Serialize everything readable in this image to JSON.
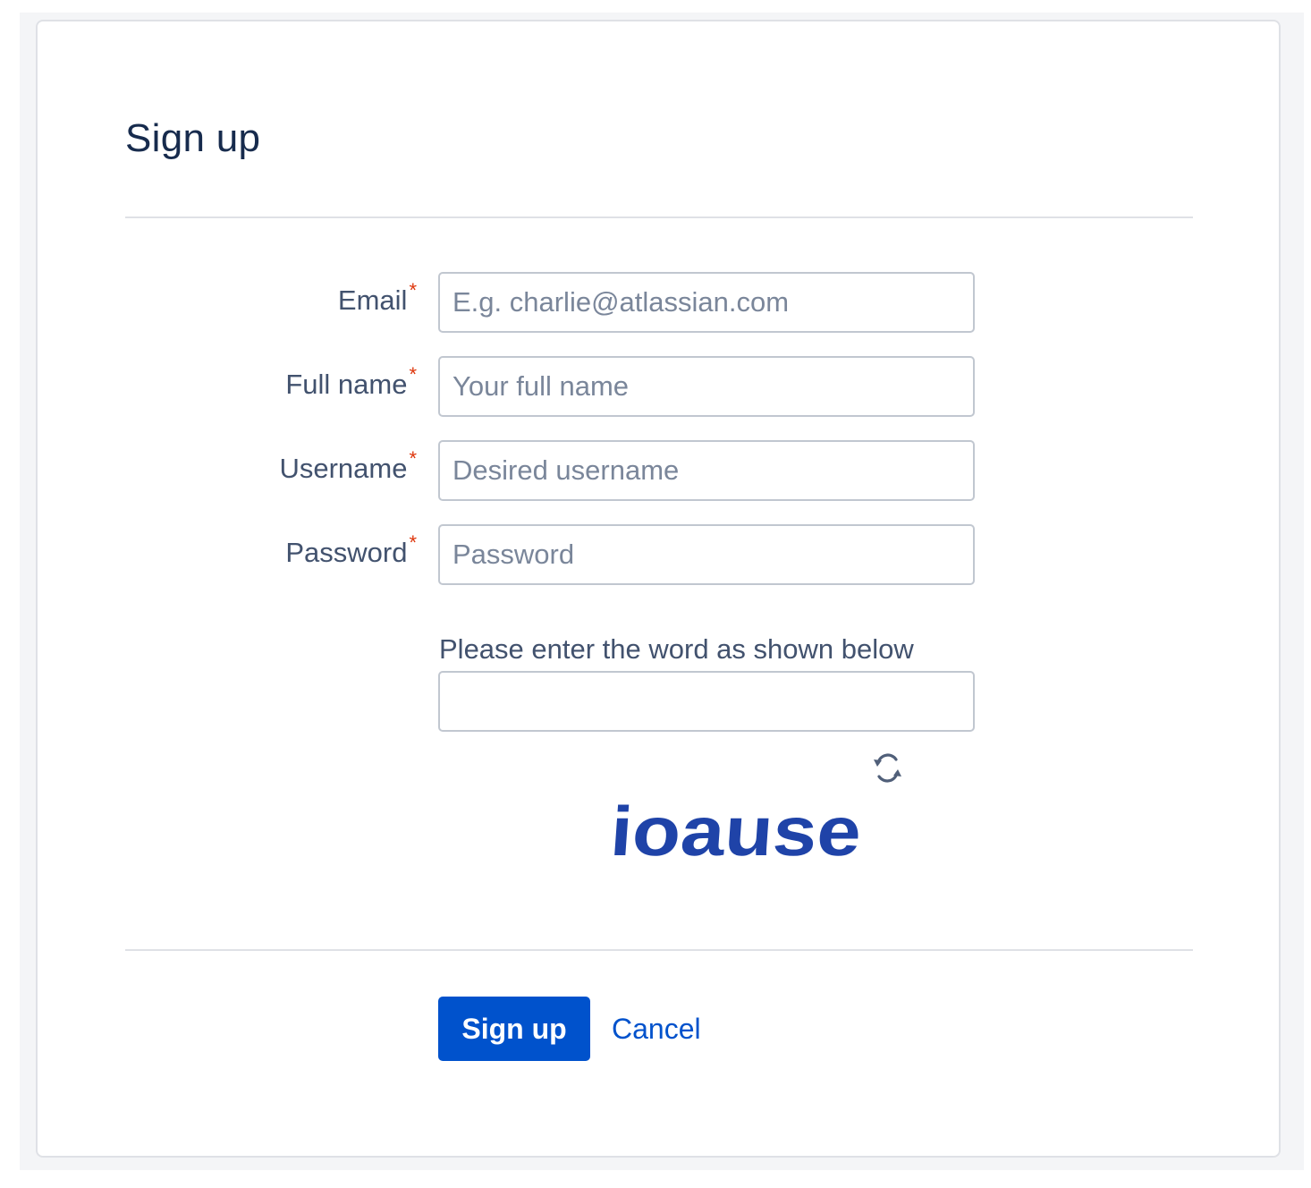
{
  "page": {
    "title": "Sign up"
  },
  "form": {
    "email": {
      "label": "Email",
      "required_mark": "*",
      "placeholder": "E.g. charlie@atlassian.com",
      "value": ""
    },
    "full_name": {
      "label": "Full name",
      "required_mark": "*",
      "placeholder": "Your full name",
      "value": ""
    },
    "username": {
      "label": "Username",
      "required_mark": "*",
      "placeholder": "Desired username",
      "value": ""
    },
    "password": {
      "label": "Password",
      "required_mark": "*",
      "placeholder": "Password",
      "value": ""
    },
    "captcha": {
      "label": "Please enter the word as shown below",
      "value": "",
      "image_word": "ioause",
      "refresh_icon": "refresh-icon"
    }
  },
  "actions": {
    "submit_label": "Sign up",
    "cancel_label": "Cancel"
  },
  "colors": {
    "primary": "#0052cc",
    "required": "#de350b",
    "captcha_text": "#1f43a8",
    "border": "#c1c7d0"
  }
}
